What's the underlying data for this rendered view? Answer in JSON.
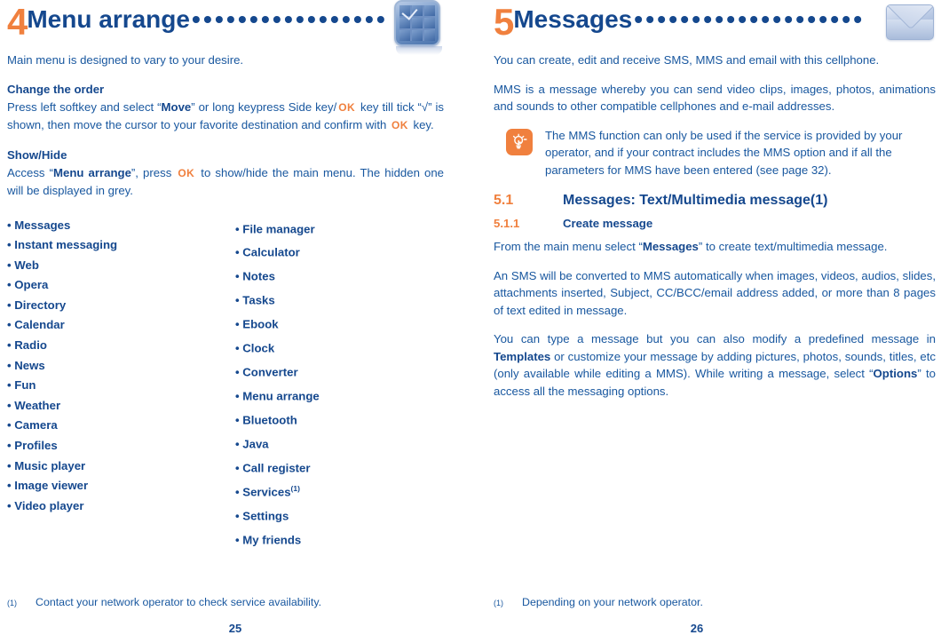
{
  "left_page": {
    "chapter": {
      "number": "4",
      "title": "Menu arrange",
      "leader": "•••••••••••••••••",
      "icon": "menu-grid-icon"
    },
    "intro": "Main menu is designed to vary to your desire.",
    "section_change_order": {
      "heading": "Change the order",
      "text_1": "Press left softkey and select “",
      "bold_1": "Move",
      "text_2": "” or long keypress Side key/",
      "ok_1": "OK",
      "text_3": " key till tick “√” is shown, then move the cursor to your favorite destination and confirm with ",
      "ok_2": "OK",
      "text_4": " key."
    },
    "section_show_hide": {
      "heading": "Show/Hide",
      "text_1": "Access “",
      "bold_1": "Menu arrange",
      "text_2": "”, press ",
      "ok_1": "OK",
      "text_3": " to show/hide the main menu. The hidden one will be displayed in grey."
    },
    "menu_column_1": [
      "• Messages",
      "• Instant messaging",
      "• Web",
      "• Opera",
      "• Directory",
      "• Calendar",
      "• Radio",
      "• News",
      "• Fun",
      "• Weather",
      "• Camera",
      "• Profiles",
      "• Music player",
      "• Image viewer",
      "• Video player"
    ],
    "menu_column_2": [
      {
        "label": "• File manager",
        "sup": ""
      },
      {
        "label": "• Calculator",
        "sup": ""
      },
      {
        "label": "• Notes",
        "sup": ""
      },
      {
        "label": "• Tasks",
        "sup": ""
      },
      {
        "label": "• Ebook",
        "sup": ""
      },
      {
        "label": "• Clock",
        "sup": ""
      },
      {
        "label": "• Converter",
        "sup": ""
      },
      {
        "label": "• Menu arrange",
        "sup": ""
      },
      {
        "label": "• Bluetooth",
        "sup": ""
      },
      {
        "label": "• Java",
        "sup": ""
      },
      {
        "label": "• Call register",
        "sup": ""
      },
      {
        "label": "• Services",
        "sup": "(1)"
      },
      {
        "label": "• Settings",
        "sup": ""
      },
      {
        "label": "• My friends",
        "sup": ""
      }
    ],
    "footnote": {
      "mark": "(1)",
      "text": "Contact your network operator to check service availability."
    },
    "page_number": "25"
  },
  "right_page": {
    "chapter": {
      "number": "5",
      "title": "Messages",
      "leader": "••••••••••••••••••••",
      "icon": "envelope-icon"
    },
    "para_1": "You can create, edit and receive SMS, MMS and email with this cellphone.",
    "para_2": "MMS is a message whereby you can send video clips, images, photos, animations and sounds to other compatible cellphones and e-mail addresses.",
    "note": {
      "icon": "lightbulb-icon",
      "icon_color": "#f0803e",
      "text": "The MMS function can only be used if the service is provided by your operator, and if your contract includes the MMS option and if all the parameters for MMS have been entered (see page 32)."
    },
    "section_5_1": {
      "number": "5.1",
      "title": "Messages: Text/Multimedia message",
      "sup": "(1)"
    },
    "section_5_1_1": {
      "number": "5.1.1",
      "title": "Create message"
    },
    "para_3_a": "From the main menu select “",
    "para_3_bold": "Messages",
    "para_3_b": "” to create text/multimedia message.",
    "para_4": "An SMS will be converted to MMS automatically when images, videos, audios, slides, attachments inserted, Subject, CC/BCC/email address added, or more than 8 pages of text edited in message.",
    "para_5_a": "You can type a message but you can also modify a predefined message in ",
    "para_5_bold_1": "Templates",
    "para_5_b": " or customize your message by adding pictures, photos, sounds, titles, etc (only available while editing a MMS). While writing a message, select “",
    "para_5_bold_2": "Options",
    "para_5_c": "” to access all the messaging options.",
    "footnote": {
      "mark": "(1)",
      "text": "Depending on your network operator."
    },
    "page_number": "26"
  },
  "colors": {
    "accent_orange": "#f0803e",
    "heading_blue": "#15488e",
    "body_blue": "#18579f"
  }
}
